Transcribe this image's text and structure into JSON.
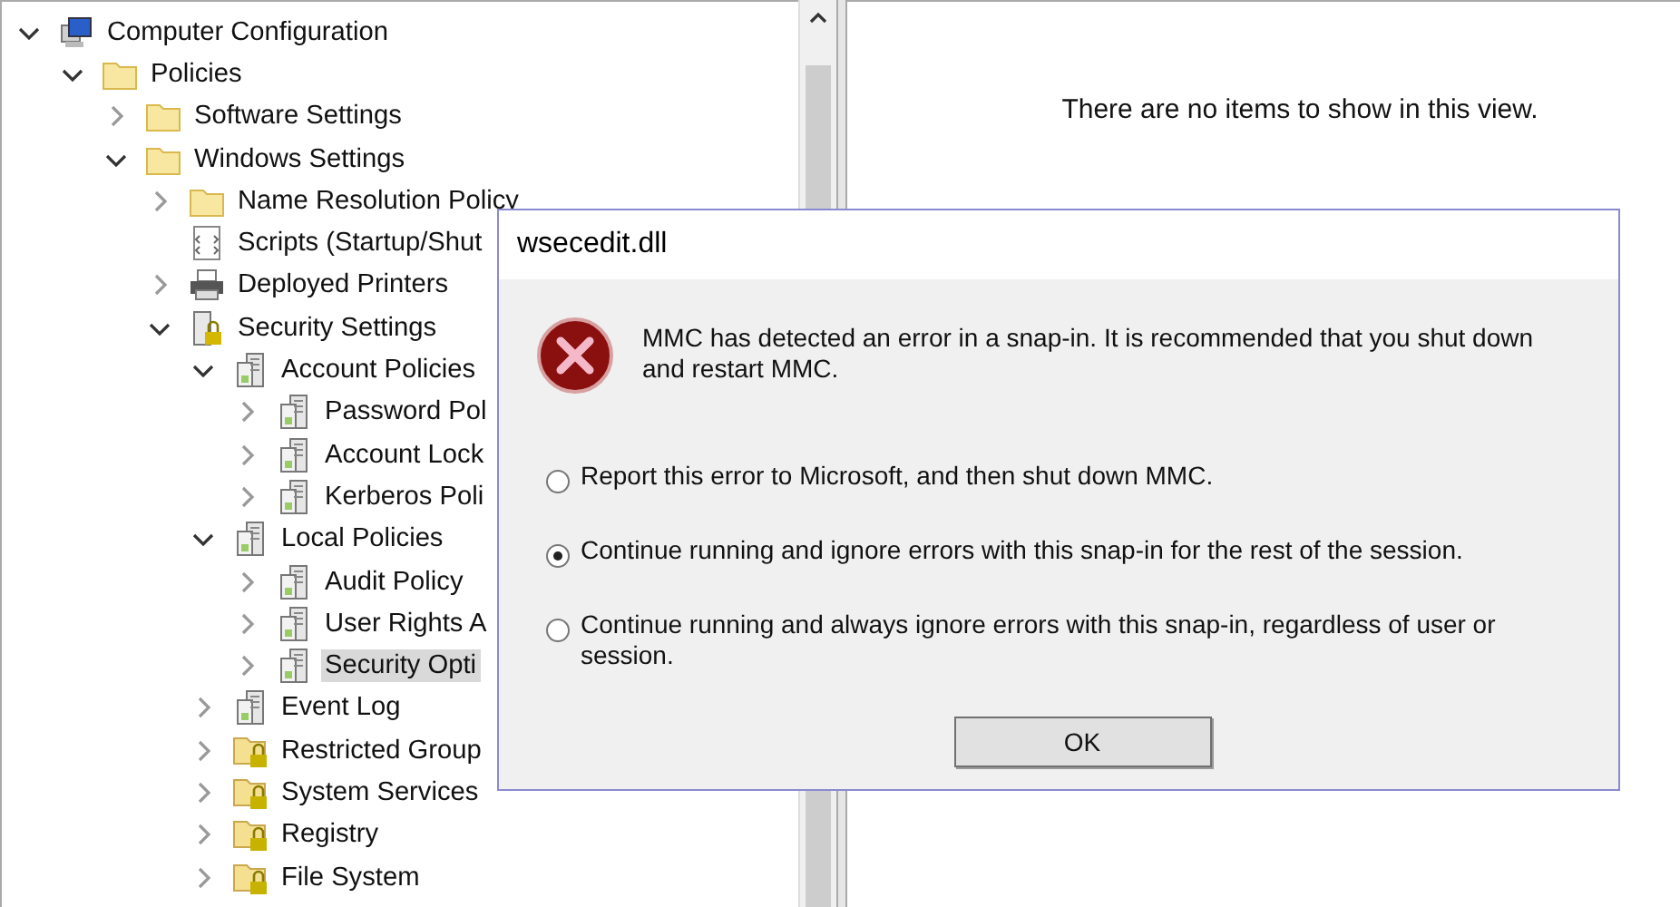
{
  "tree": [
    {
      "label": "Computer Configuration",
      "kind": "computer",
      "expanded": true,
      "selected": false,
      "children": [
        {
          "label": "Policies",
          "kind": "folder",
          "expanded": true,
          "selected": false,
          "children": [
            {
              "label": "Software Settings",
              "kind": "folder",
              "expanded": false,
              "selected": false
            },
            {
              "label": "Windows Settings",
              "kind": "folder",
              "expanded": true,
              "selected": false,
              "children": [
                {
                  "label": "Name Resolution Policy",
                  "kind": "folder",
                  "expanded": false,
                  "selected": false
                },
                {
                  "label": "Scripts (Startup/Shut",
                  "kind": "script",
                  "selected": false
                },
                {
                  "label": "Deployed Printers",
                  "kind": "printer",
                  "expanded": false,
                  "selected": false
                },
                {
                  "label": "Security Settings",
                  "kind": "secure-server",
                  "expanded": true,
                  "selected": false,
                  "children": [
                    {
                      "label": "Account Policies",
                      "kind": "policy",
                      "expanded": true,
                      "selected": false,
                      "children": [
                        {
                          "label": "Password Pol",
                          "kind": "policy",
                          "expanded": false,
                          "selected": false
                        },
                        {
                          "label": "Account Lock",
                          "kind": "policy",
                          "expanded": false,
                          "selected": false
                        },
                        {
                          "label": "Kerberos Poli",
                          "kind": "policy",
                          "expanded": false,
                          "selected": false
                        }
                      ]
                    },
                    {
                      "label": "Local Policies",
                      "kind": "policy",
                      "expanded": true,
                      "selected": false,
                      "children": [
                        {
                          "label": "Audit Policy",
                          "kind": "policy",
                          "expanded": false,
                          "selected": false
                        },
                        {
                          "label": "User Rights A",
                          "kind": "policy",
                          "expanded": false,
                          "selected": false
                        },
                        {
                          "label": "Security Opti",
                          "kind": "policy",
                          "expanded": false,
                          "selected": true
                        }
                      ]
                    },
                    {
                      "label": "Event Log",
                      "kind": "policy",
                      "expanded": false,
                      "selected": false
                    },
                    {
                      "label": "Restricted Group",
                      "kind": "locked-folder",
                      "expanded": false,
                      "selected": false
                    },
                    {
                      "label": "System Services",
                      "kind": "locked-folder",
                      "expanded": false,
                      "selected": false
                    },
                    {
                      "label": "Registry",
                      "kind": "locked-folder",
                      "expanded": false,
                      "selected": false
                    },
                    {
                      "label": "File System",
                      "kind": "locked-folder",
                      "expanded": false,
                      "selected": false
                    }
                  ]
                }
              ]
            }
          ]
        }
      ]
    }
  ],
  "details": {
    "empty_message": "There are no items to show in this view."
  },
  "dialog": {
    "title": "wsecedit.dll",
    "message": "MMC has detected an error in a snap-in. It is recommended that you shut down and restart MMC.",
    "options": [
      {
        "label": "Report this error to Microsoft, and then shut down MMC.",
        "selected": false
      },
      {
        "label": "Continue running and ignore errors with this snap-in for the rest of the session.",
        "selected": true
      },
      {
        "label": "Continue running and always ignore errors with this snap-in, regardless of user or session.",
        "selected": false
      }
    ],
    "button": "OK"
  }
}
